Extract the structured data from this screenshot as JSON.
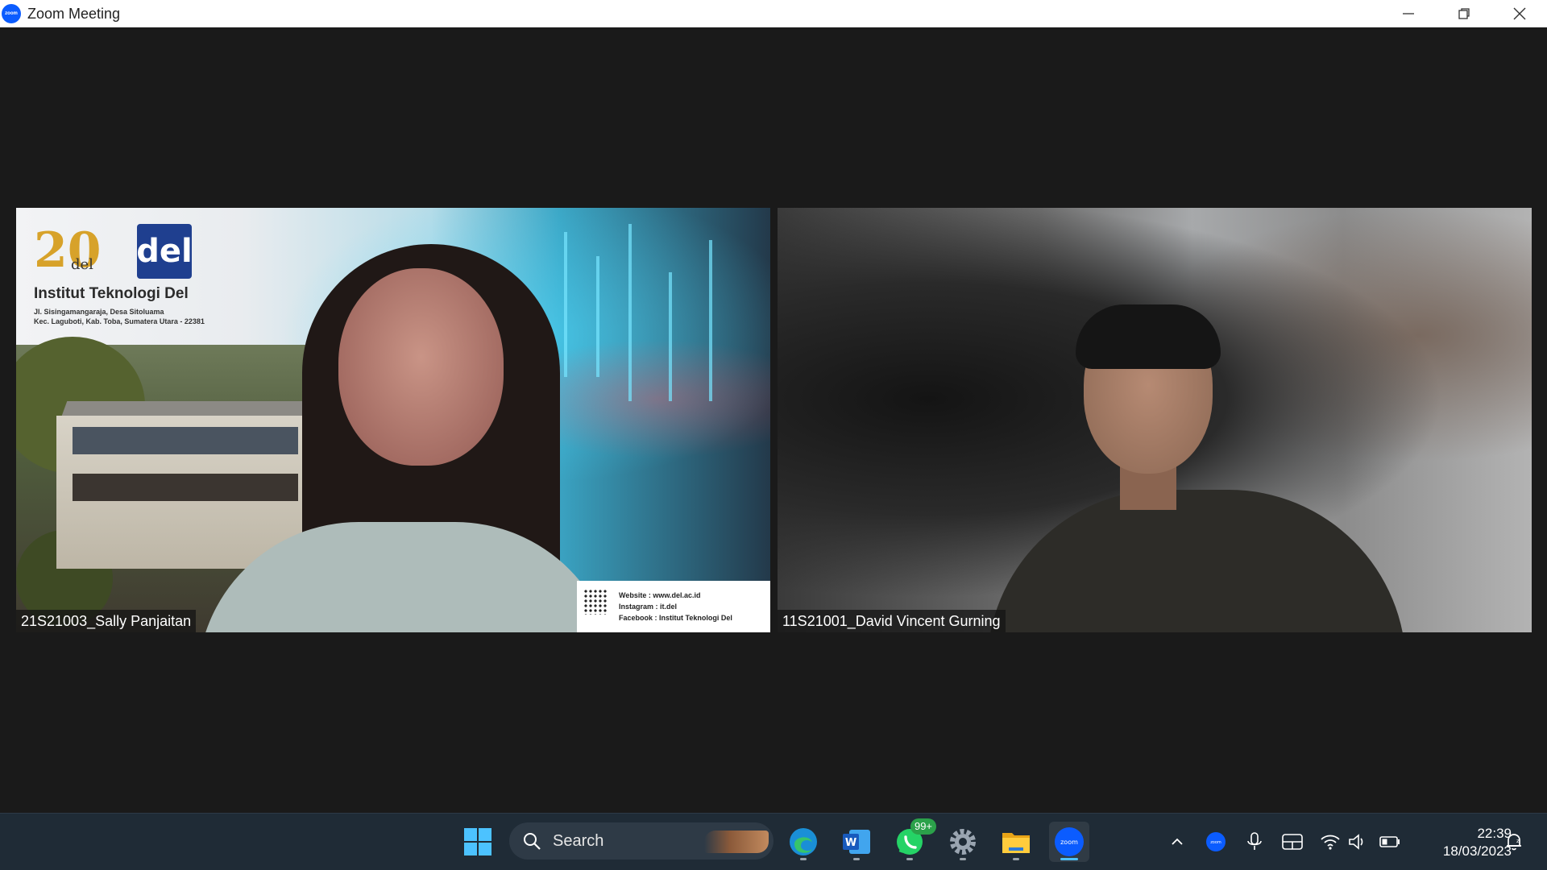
{
  "window": {
    "title": "Zoom Meeting",
    "app_logo_text": "zoom"
  },
  "participants": [
    {
      "name": "21S21003_Sally Panjaitan",
      "background": {
        "logo_20_text": "20",
        "logo_del_small": "del",
        "logo_del_big": "del",
        "institution": "Institut Teknologi Del",
        "address_line1": "Jl. Sisingamangaraja, Desa Sitoluama",
        "address_line2": "Kec. Laguboti, Kab. Toba, Sumatera Utara - 22381",
        "website": "Website    : www.del.ac.id",
        "instagram": "Instagram : it.del",
        "facebook": "Facebook  : Institut Teknologi Del"
      }
    },
    {
      "name": "11S21001_David Vincent Gurning"
    }
  ],
  "taskbar": {
    "search_label": "Search",
    "whatsapp_badge": "99+",
    "zoom_label": "zoom",
    "tray_zoom_label": "zoom",
    "time": "22:39",
    "date": "18/03/2023",
    "colors": {
      "background": "#1f2b36",
      "accent": "#4cc2ff",
      "zoom_blue": "#0b5cff",
      "whatsapp_green": "#2ba14a"
    }
  }
}
